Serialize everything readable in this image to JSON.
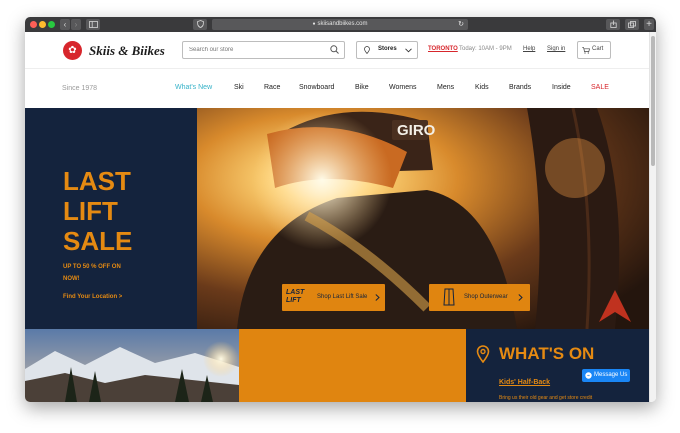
{
  "browser": {
    "url": "skiisandbiikes.com",
    "lock_icon": "lock-icon",
    "tab_new_icon": "plus-icon",
    "colors": {
      "chrome": "#3a3a3c",
      "close": "#fe5f57",
      "minimize": "#febb2e",
      "zoom": "#28c840"
    }
  },
  "header": {
    "brand": "Skiis & Biikes",
    "search_placeholder": "Search our store",
    "stores_label": "Stores",
    "city": "TORONTO",
    "hours": "Today: 10AM - 9PM",
    "help": "Help",
    "signin": "Sign in",
    "cart": "Cart"
  },
  "nav": {
    "since": "Since 1978",
    "items": [
      {
        "label": "What's New",
        "color": "#36b2c8"
      },
      {
        "label": "Ski",
        "color": "#222222"
      },
      {
        "label": "Race",
        "color": "#222222"
      },
      {
        "label": "Snowboard",
        "color": "#222222"
      },
      {
        "label": "Bike",
        "color": "#222222"
      },
      {
        "label": "Womens",
        "color": "#222222"
      },
      {
        "label": "Mens",
        "color": "#222222"
      },
      {
        "label": "Kids",
        "color": "#222222"
      },
      {
        "label": "Brands",
        "color": "#222222"
      },
      {
        "label": "Inside",
        "color": "#222222"
      },
      {
        "label": "SALE",
        "color": "#d7262c"
      }
    ]
  },
  "hero": {
    "title_line1": "LAST",
    "title_line2": "LIFT",
    "title_line3": "SALE",
    "subtitle": "UP TO 50 % OFF ON NOW!",
    "location_link": "Find Your Location >",
    "helmet_brand": "GIRO",
    "promos": [
      {
        "logo": "LAST LIFT",
        "label": "Shop Last Lift Sale"
      },
      {
        "label": "Shop Outerwear"
      }
    ],
    "colors": {
      "navy": "#14233d",
      "orange": "#e58a12"
    }
  },
  "whats_on": {
    "title": "WHAT'S ON",
    "link": "Kids' Half-Back",
    "description": "Bring us their old gear and get store credit"
  },
  "messenger": {
    "label": "Message Us",
    "color": "#1a86f5"
  }
}
